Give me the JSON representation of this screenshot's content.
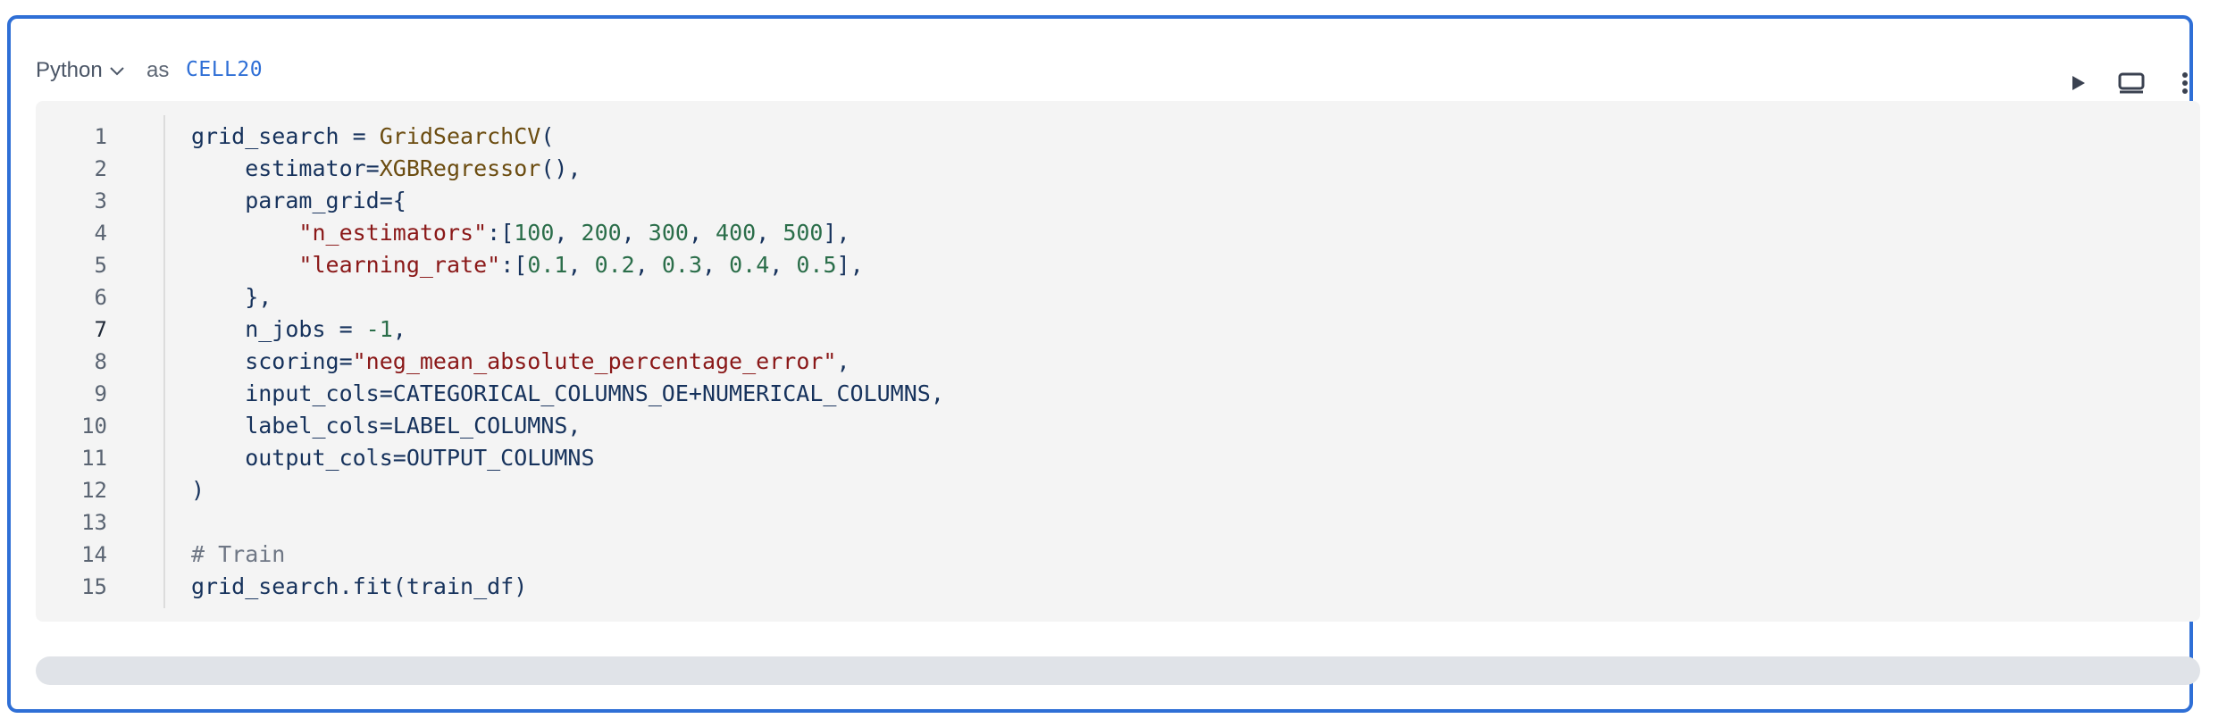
{
  "cell": {
    "language": "Python",
    "as_label": "as",
    "name": "CELL20"
  },
  "toolbar": {
    "run_icon": "play-icon",
    "layout_icon": "panel-layout-icon",
    "more_icon": "vertical-ellipsis-icon"
  },
  "editor": {
    "active_line": 7,
    "line_numbers": [
      "1",
      "2",
      "3",
      "4",
      "5",
      "6",
      "7",
      "8",
      "9",
      "10",
      "11",
      "12",
      "13",
      "14",
      "15"
    ],
    "lines": [
      [
        {
          "t": "id",
          "v": "grid_search = "
        },
        {
          "t": "fn",
          "v": "GridSearchCV"
        },
        {
          "t": "id",
          "v": "("
        }
      ],
      [
        {
          "t": "id",
          "v": "    estimator="
        },
        {
          "t": "fn",
          "v": "XGBRegressor"
        },
        {
          "t": "id",
          "v": "(),"
        }
      ],
      [
        {
          "t": "id",
          "v": "    param_grid={"
        }
      ],
      [
        {
          "t": "id",
          "v": "        "
        },
        {
          "t": "str",
          "v": "\"n_estimators\""
        },
        {
          "t": "id",
          "v": ":["
        },
        {
          "t": "num",
          "v": "100"
        },
        {
          "t": "id",
          "v": ", "
        },
        {
          "t": "num",
          "v": "200"
        },
        {
          "t": "id",
          "v": ", "
        },
        {
          "t": "num",
          "v": "300"
        },
        {
          "t": "id",
          "v": ", "
        },
        {
          "t": "num",
          "v": "400"
        },
        {
          "t": "id",
          "v": ", "
        },
        {
          "t": "num",
          "v": "500"
        },
        {
          "t": "id",
          "v": "],"
        }
      ],
      [
        {
          "t": "id",
          "v": "        "
        },
        {
          "t": "str",
          "v": "\"learning_rate\""
        },
        {
          "t": "id",
          "v": ":["
        },
        {
          "t": "num",
          "v": "0.1"
        },
        {
          "t": "id",
          "v": ", "
        },
        {
          "t": "num",
          "v": "0.2"
        },
        {
          "t": "id",
          "v": ", "
        },
        {
          "t": "num",
          "v": "0.3"
        },
        {
          "t": "id",
          "v": ", "
        },
        {
          "t": "num",
          "v": "0.4"
        },
        {
          "t": "id",
          "v": ", "
        },
        {
          "t": "num",
          "v": "0.5"
        },
        {
          "t": "id",
          "v": "],"
        }
      ],
      [
        {
          "t": "id",
          "v": "    },"
        }
      ],
      [
        {
          "t": "id",
          "v": "    n_jobs = "
        },
        {
          "t": "num",
          "v": "-1"
        },
        {
          "t": "id",
          "v": ","
        }
      ],
      [
        {
          "t": "id",
          "v": "    scoring="
        },
        {
          "t": "str",
          "v": "\"neg_mean_absolute_percentage_error\""
        },
        {
          "t": "id",
          "v": ","
        }
      ],
      [
        {
          "t": "id",
          "v": "    input_cols=CATEGORICAL_COLUMNS_OE+NUMERICAL_COLUMNS,"
        }
      ],
      [
        {
          "t": "id",
          "v": "    label_cols=LABEL_COLUMNS,"
        }
      ],
      [
        {
          "t": "id",
          "v": "    output_cols=OUTPUT_COLUMNS"
        }
      ],
      [
        {
          "t": "id",
          "v": ")"
        }
      ],
      [
        {
          "t": "id",
          "v": ""
        }
      ],
      [
        {
          "t": "cmt",
          "v": "# Train"
        }
      ],
      [
        {
          "t": "id",
          "v": "grid_search.fit(train_df)"
        }
      ]
    ]
  },
  "colors": {
    "accent": "#2f6fd6",
    "editor_bg": "#f4f4f4",
    "output_bar": "#e0e3e8"
  }
}
